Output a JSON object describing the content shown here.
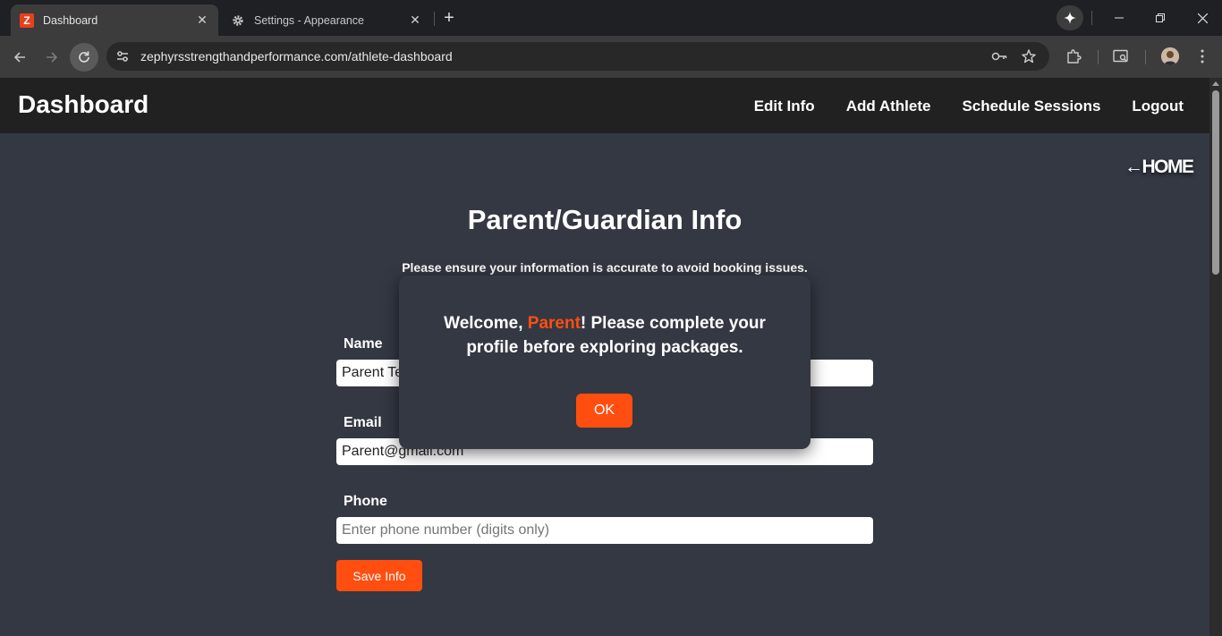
{
  "browser": {
    "tabs": [
      {
        "title": "Dashboard",
        "icon": "site-favicon-z",
        "active": true
      },
      {
        "title": "Settings - Appearance",
        "icon": "gear-icon",
        "active": false
      }
    ],
    "favicon_letter": "Z",
    "url": "zephyrsstrengthandperformance.com/athlete-dashboard"
  },
  "header": {
    "title": "Dashboard",
    "nav": [
      "Edit Info",
      "Add Athlete",
      "Schedule Sessions",
      "Logout"
    ]
  },
  "home_link": "←HOME",
  "form": {
    "title": "Parent/Guardian Info",
    "subtitle": "Please ensure your information is accurate to avoid booking issues.",
    "name_label": "Name",
    "name_value": "Parent Test",
    "email_label": "Email",
    "email_value": "Parent@gmail.com",
    "phone_label": "Phone",
    "phone_placeholder": "Enter phone number (digits only)",
    "save_label": "Save Info"
  },
  "modal": {
    "prefix": "Welcome, ",
    "name": "Parent",
    "suffix": "! Please complete your profile before exploring packages.",
    "ok_label": "OK"
  },
  "colors": {
    "accent": "#ff4e0f",
    "page_bg": "#343843",
    "header_bg": "#212121"
  }
}
